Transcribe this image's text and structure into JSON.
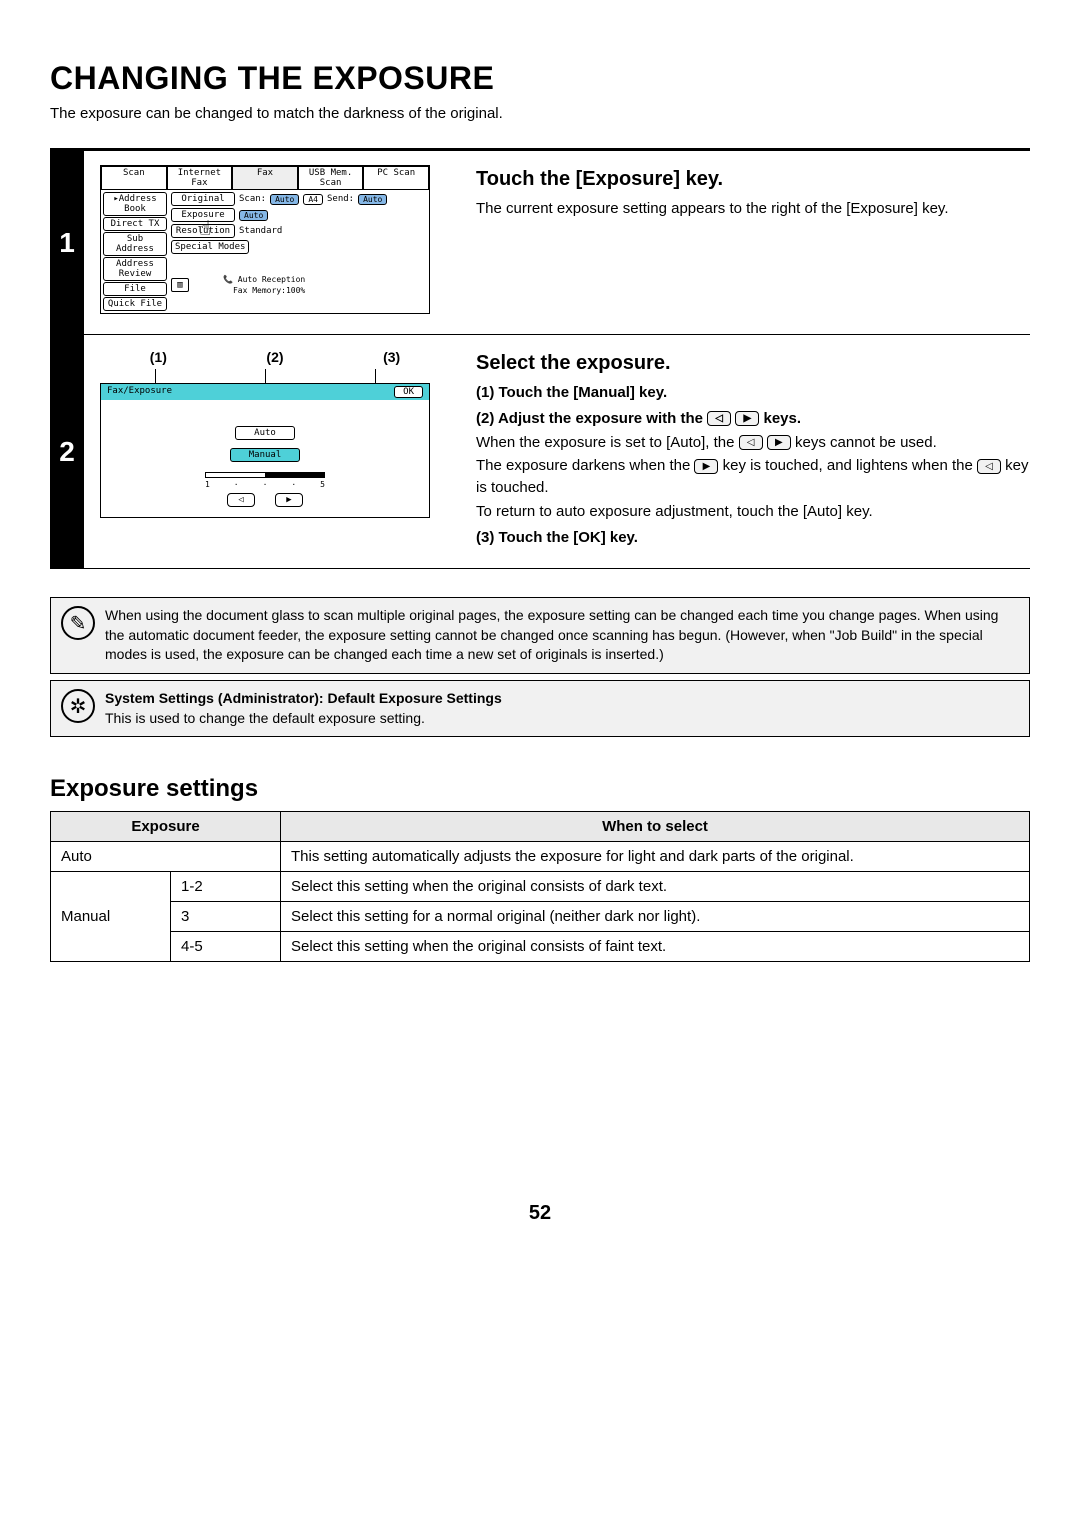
{
  "title": "CHANGING THE EXPOSURE",
  "intro": "The exposure can be changed to match the darkness of the original.",
  "page_number": "52",
  "step1": {
    "num": "1",
    "heading": "Touch the [Exposure] key.",
    "desc": "The current exposure setting appears to the right of the [Exposure] key.",
    "tabs": [
      "Scan",
      "Internet Fax",
      "Fax",
      "USB Mem. Scan",
      "PC Scan"
    ],
    "leftcol": [
      "Address Book",
      "Direct TX",
      "Sub Address",
      "Address Review",
      "File",
      "Quick File"
    ],
    "midcol": [
      "Original",
      "Exposure",
      "Resolution",
      "Special Modes"
    ],
    "scan_label": "Scan:",
    "send_label": "Send:",
    "auto_pill": "Auto",
    "a4_pill": "A4",
    "exposure_val": "Auto",
    "resolution_val": "Standard",
    "status_line1": "Auto Reception",
    "status_line2": "Fax Memory:100%"
  },
  "step2": {
    "num": "2",
    "callouts": [
      "(1)",
      "(2)",
      "(3)"
    ],
    "heading": "Select the exposure.",
    "sub1": "(1)  Touch the [Manual] key.",
    "sub2_a": "(2)  Adjust the exposure with the ",
    "sub2_b": " keys.",
    "para1": "When the exposure is set to [Auto], the ",
    "para1b": " keys cannot be used.",
    "para2a": "The exposure darkens when the ",
    "para2b": " key is touched, and lightens when the ",
    "para2c": " key is touched.",
    "para3": "To return to auto exposure adjustment, touch the [Auto] key.",
    "sub3": "(3)  Touch the [OK] key.",
    "panel_title": "Fax/Exposure",
    "ok_label": "OK",
    "auto_label": "Auto",
    "manual_label": "Manual",
    "scale_min": "1",
    "scale_max": "5"
  },
  "note1": "When using the document glass to scan multiple original pages, the exposure setting can be changed each time you change pages. When using the automatic document feeder, the exposure setting cannot be changed once scanning has begun. (However, when \"Job Build\" in the special modes is used, the exposure can be changed each time a new set of originals is inserted.)",
  "note2_title": "System Settings (Administrator): Default Exposure Settings",
  "note2_body": "This is used to change the default exposure setting.",
  "settings_heading": "Exposure settings",
  "settings_th1": "Exposure",
  "settings_th2": "When to select",
  "row_auto_l": "Auto",
  "row_auto_r": "This setting automatically adjusts the exposure for light and dark parts of the original.",
  "row_manual": "Manual",
  "row_12_l": "1-2",
  "row_12_r": "Select this setting when the original consists of dark text.",
  "row_3_l": "3",
  "row_3_r": "Select this setting for a normal original (neither dark nor light).",
  "row_45_l": "4-5",
  "row_45_r": "Select this setting when the original consists of faint text."
}
